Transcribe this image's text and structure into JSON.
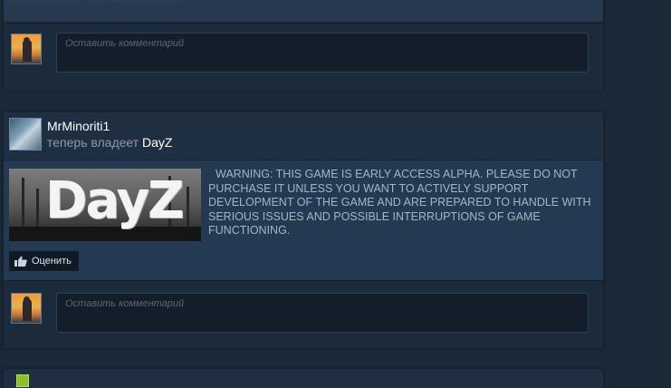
{
  "feed": {
    "top_item": {
      "comment_placeholder": "Оставить комментарий"
    },
    "main_item": {
      "username": "MrMinoriti1",
      "action_text": "теперь владеет",
      "game_name": "DayZ",
      "game_logo_text": "DayZ",
      "description": "WARNING: THIS GAME IS EARLY ACCESS ALPHA. PLEASE DO NOT PURCHASE IT UNLESS YOU WANT TO ACTIVELY SUPPORT DEVELOPMENT OF THE GAME AND ARE PREPARED TO HANDLE WITH SERIOUS ISSUES AND POSSIBLE INTERRUPTIONS OF GAME FUNCTIONING.",
      "rate_label": "Оценить",
      "comment_placeholder": "Оставить комментарий"
    }
  },
  "colors": {
    "page_bg": "#1b2838",
    "card_bg": "#1e2e40",
    "highlight_bg": "#233a52",
    "text_primary": "#ffffff",
    "text_muted": "#8f98a0",
    "text_description": "#a8b4bf"
  },
  "icons": {
    "rate": "thumbs-up-icon"
  }
}
